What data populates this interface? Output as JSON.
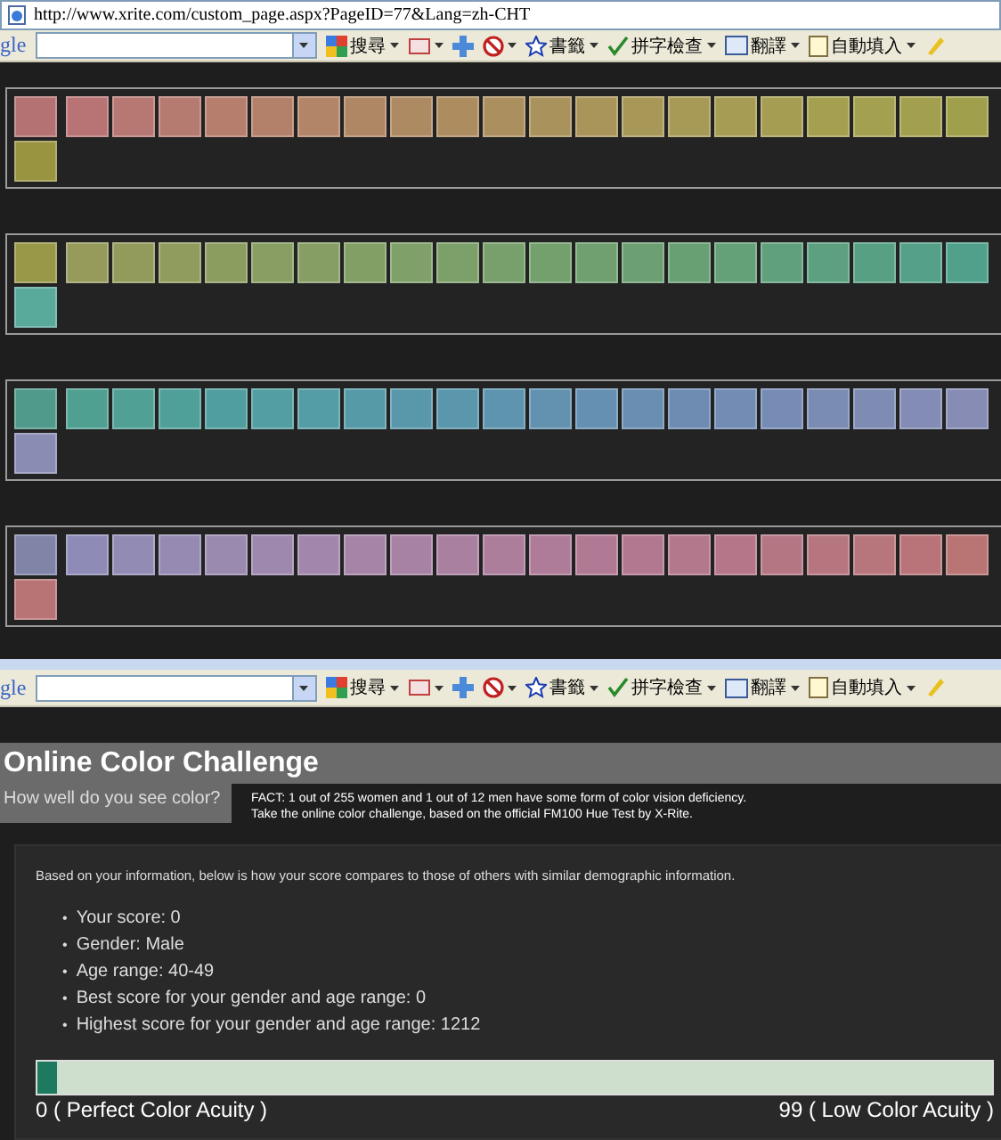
{
  "browser_top": {
    "address": "http://www.xrite.com/custom_page.aspx?PageID=77&Lang=zh-CHT",
    "toolbar": {
      "logo_fragment": "gle",
      "buttons": [
        {
          "kind": "search",
          "label": "搜尋"
        },
        {
          "kind": "popup"
        },
        {
          "kind": "plus"
        },
        {
          "kind": "block"
        },
        {
          "kind": "star",
          "label": "書籤"
        },
        {
          "kind": "spell",
          "label": "拼字檢查"
        },
        {
          "kind": "translate",
          "label": "翻譯"
        },
        {
          "kind": "autofill",
          "label": "自動填入"
        },
        {
          "kind": "pencil"
        }
      ]
    }
  },
  "panels": [
    {
      "start": {
        "color": "#b47272"
      },
      "chips": [
        {
          "color": "#b87474"
        },
        {
          "color": "#b77873"
        },
        {
          "color": "#b67b70"
        },
        {
          "color": "#b57e6d"
        },
        {
          "color": "#b3806a"
        },
        {
          "color": "#b28468"
        },
        {
          "color": "#b08765"
        },
        {
          "color": "#ae8a63"
        },
        {
          "color": "#ad8d60"
        },
        {
          "color": "#ab8f5e"
        },
        {
          "color": "#aa925c"
        },
        {
          "color": "#a9955a"
        },
        {
          "color": "#a89858"
        },
        {
          "color": "#a79a56"
        },
        {
          "color": "#a69c54"
        },
        {
          "color": "#a59e52"
        },
        {
          "color": "#a4a050"
        },
        {
          "color": "#a3a04f"
        },
        {
          "color": "#a2a04e"
        },
        {
          "color": "#a0a04c"
        }
      ],
      "end": {
        "color": "#989440"
      }
    },
    {
      "start": {
        "color": "#989848"
      },
      "chips": [
        {
          "color": "#969a5a"
        },
        {
          "color": "#939b5c"
        },
        {
          "color": "#909c5e"
        },
        {
          "color": "#8c9d60"
        },
        {
          "color": "#899e62"
        },
        {
          "color": "#869e64"
        },
        {
          "color": "#829f66"
        },
        {
          "color": "#7fa068"
        },
        {
          "color": "#7ca06a"
        },
        {
          "color": "#78a06c"
        },
        {
          "color": "#74a06e"
        },
        {
          "color": "#70a070"
        },
        {
          "color": "#6ca072"
        },
        {
          "color": "#68a074"
        },
        {
          "color": "#64a078"
        },
        {
          "color": "#60a07c"
        },
        {
          "color": "#5ca080"
        },
        {
          "color": "#58a084"
        },
        {
          "color": "#54a088"
        },
        {
          "color": "#50a08c"
        }
      ],
      "end": {
        "color": "#5aaa9c"
      }
    },
    {
      "start": {
        "color": "#4f9a8a"
      },
      "chips": [
        {
          "color": "#50a092"
        },
        {
          "color": "#50a096"
        },
        {
          "color": "#50a09a"
        },
        {
          "color": "#509f9e"
        },
        {
          "color": "#529ea2"
        },
        {
          "color": "#549ca6"
        },
        {
          "color": "#569aa8"
        },
        {
          "color": "#5898aa"
        },
        {
          "color": "#5a96ac"
        },
        {
          "color": "#5e94ae"
        },
        {
          "color": "#6292b0"
        },
        {
          "color": "#6690b2"
        },
        {
          "color": "#6a8eb2"
        },
        {
          "color": "#6e8cb2"
        },
        {
          "color": "#728cb4"
        },
        {
          "color": "#768cb4"
        },
        {
          "color": "#7a8cb4"
        },
        {
          "color": "#7e8cb4"
        },
        {
          "color": "#828cb4"
        },
        {
          "color": "#868cb4"
        }
      ],
      "end": {
        "color": "#8a8cb4"
      }
    },
    {
      "start": {
        "color": "#8085a8"
      },
      "chips": [
        {
          "color": "#8e8cb6"
        },
        {
          "color": "#928cb4"
        },
        {
          "color": "#968ab2"
        },
        {
          "color": "#9a8ab0"
        },
        {
          "color": "#9e88ae"
        },
        {
          "color": "#a286ac"
        },
        {
          "color": "#a684a8"
        },
        {
          "color": "#a882a4"
        },
        {
          "color": "#aa80a0"
        },
        {
          "color": "#ac7e9c"
        },
        {
          "color": "#ae7c98"
        },
        {
          "color": "#b07a94"
        },
        {
          "color": "#b27890"
        },
        {
          "color": "#b3788c"
        },
        {
          "color": "#b47688"
        },
        {
          "color": "#b57684"
        },
        {
          "color": "#b67680"
        },
        {
          "color": "#b7767c"
        },
        {
          "color": "#b87478"
        },
        {
          "color": "#b97474"
        }
      ],
      "end": {
        "color": "#b87474"
      }
    }
  ],
  "browser_bottom": {
    "toolbar": {
      "logo_fragment": "gle",
      "buttons": [
        {
          "kind": "search",
          "label": "搜尋"
        },
        {
          "kind": "popup"
        },
        {
          "kind": "plus"
        },
        {
          "kind": "block"
        },
        {
          "kind": "star",
          "label": "書籤"
        },
        {
          "kind": "spell",
          "label": "拼字檢查"
        },
        {
          "kind": "translate",
          "label": "翻譯"
        },
        {
          "kind": "autofill",
          "label": "自動填入"
        },
        {
          "kind": "pencil"
        }
      ]
    }
  },
  "header": {
    "title": "Online Color Challenge",
    "tagline": "How well do you see color?",
    "fact": [
      "FACT: 1 out of 255 women and 1 out of 12 men have some form of color vision deficiency.",
      "Take the online color challenge, based on the official FM100 Hue Test by X-Rite."
    ]
  },
  "results": {
    "intro": "Based on your information, below is how your score compares to those of others with similar demographic information.",
    "items": [
      {
        "bullet": "•",
        "text": "Your score: 0"
      },
      {
        "bullet": "•",
        "text": "Gender: Male"
      },
      {
        "bullet": "•",
        "text": "Age range: 40-49"
      },
      {
        "bullet": "•",
        "text": "Best score for your gender and age range: 0"
      },
      {
        "bullet": "•",
        "text": "Highest score for your gender and age range: 1212"
      }
    ],
    "score_bar": {
      "level": 0.02
    },
    "scale_left": "0 ( Perfect Color Acuity )",
    "scale_right": "99 ( Low Color Acuity )"
  }
}
